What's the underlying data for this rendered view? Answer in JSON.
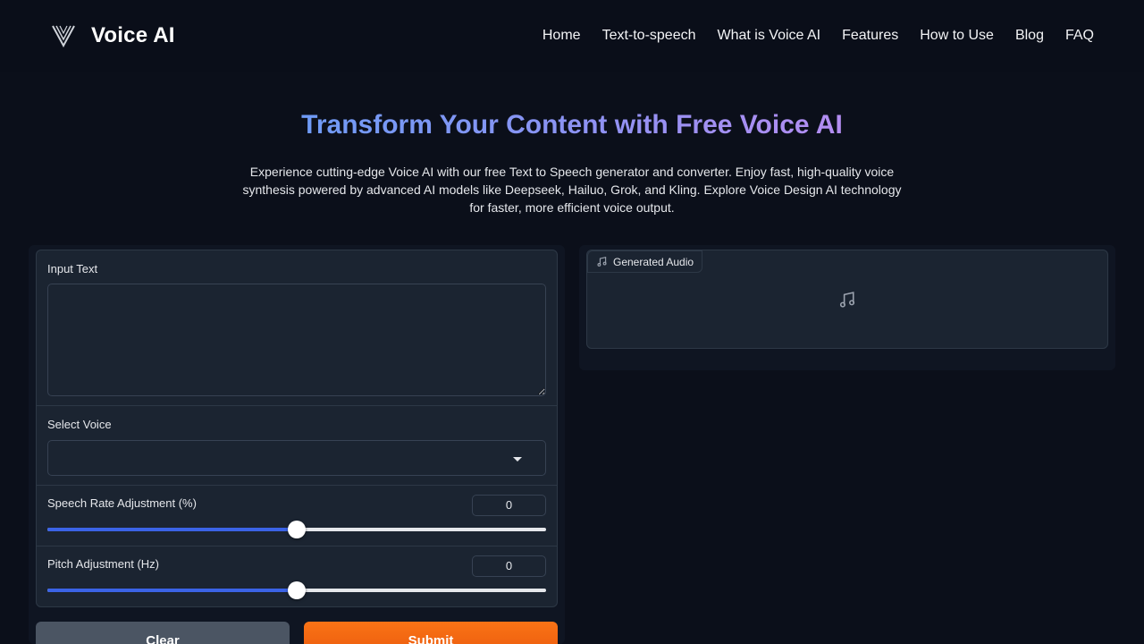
{
  "header": {
    "brand": "Voice AI",
    "nav": [
      "Home",
      "Text-to-speech",
      "What is Voice AI",
      "Features",
      "How to Use",
      "Blog",
      "FAQ"
    ]
  },
  "hero": {
    "title": "Transform Your Content with Free Voice AI",
    "description": "Experience cutting-edge Voice AI with our free Text to Speech generator and converter. Enjoy fast, high-quality voice synthesis powered by advanced AI models like Deepseek, Hailuo, Grok, and Kling. Explore Voice Design AI technology for faster, more efficient voice output."
  },
  "form": {
    "input_label": "Input Text",
    "input_value": "",
    "voice_label": "Select Voice",
    "voice_value": "",
    "rate_label": "Speech Rate Adjustment (%)",
    "rate_value": "0",
    "rate_fraction": 0.5,
    "pitch_label": "Pitch Adjustment (Hz)",
    "pitch_value": "0",
    "pitch_fraction": 0.5,
    "clear_label": "Clear",
    "submit_label": "Submit"
  },
  "output": {
    "label": "Generated Audio"
  },
  "colors": {
    "background": "#0b0f1a",
    "panel": "#1b2431",
    "accent_blue": "#3b63e6",
    "submit_orange": "#f97316",
    "clear_gray": "#4b5563"
  },
  "icons": {
    "logo": "v-logo-icon",
    "audio_tag": "music-note-icon",
    "audio_placeholder": "music-note-icon",
    "select_caret": "chevron-down-icon"
  }
}
